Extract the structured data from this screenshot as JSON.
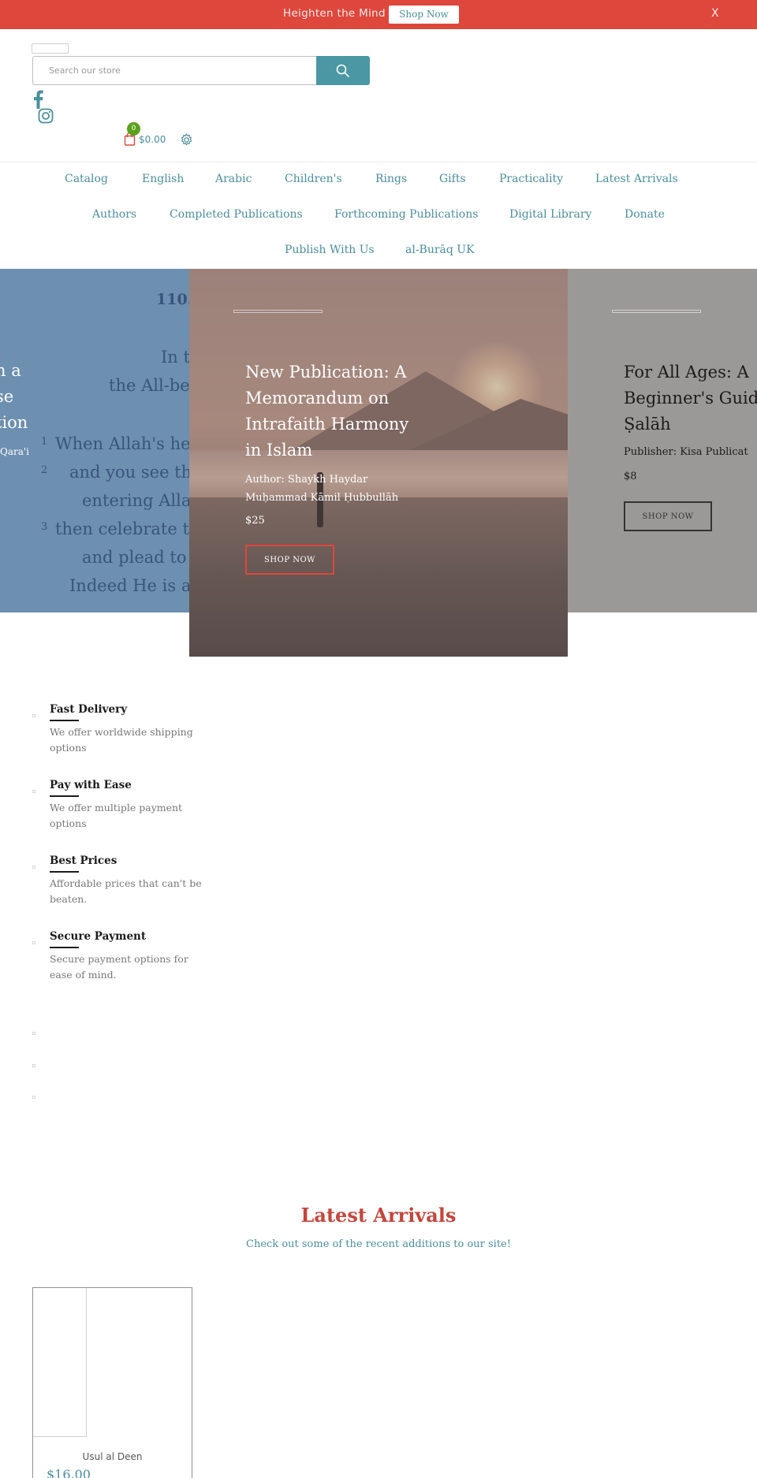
{
  "announcement": {
    "text": "Heighten the Mind",
    "button_label": "Shop Now",
    "close_label": "X"
  },
  "header": {
    "search_placeholder": "Search our store",
    "search_icon": "search-icon",
    "social": [
      "facebook-icon",
      "instagram-icon"
    ],
    "cart_count": "0",
    "cart_total": "$0.00",
    "settings_icon": "gear-icon"
  },
  "nav": {
    "row1": [
      "Catalog",
      "English",
      "Arabic",
      "Children's",
      "Rings",
      "Gifts",
      "Practicality",
      "Latest Arrivals"
    ],
    "row2": [
      "Authors",
      "Completed Publications",
      "Forthcoming Publications",
      "Digital Library",
      "Donate"
    ],
    "row3": [
      "Publish With Us",
      "al-Burāq UK"
    ]
  },
  "hero": {
    "left": {
      "scripture": [
        "110.",
        "In t",
        "the All-be",
        "When Allah's hel",
        "and you see the",
        "entering Allah",
        "then celebrate the",
        "and plead to H",
        "Indeed He is al"
      ],
      "title_lines": [
        "h a",
        "se",
        "tion"
      ],
      "subtitle": "Qara'i"
    },
    "center": {
      "title_lines": [
        "New Publication: A",
        "Memorandum on",
        "Intrafaith Harmony",
        "in Islam"
      ],
      "author_lines": [
        "Author: Shaykh Haydar",
        "Muḥammad Kāmil Ḥubbullāh"
      ],
      "price": "$25",
      "button_label": "SHOP NOW"
    },
    "right": {
      "title_lines": [
        "For All Ages: A",
        "Beginner's Guid",
        "Ṣalāh"
      ],
      "publisher": "Publisher: Kisa Publicat",
      "price": "$8",
      "button_label": "SHOP NOW"
    }
  },
  "features": [
    {
      "title": "Fast Delivery",
      "desc_lines": [
        "We offer worldwide shipping",
        "options"
      ]
    },
    {
      "title": "Pay with Ease",
      "desc_lines": [
        "We offer multiple payment",
        "options"
      ]
    },
    {
      "title": "Best Prices",
      "desc_lines": [
        "Affordable prices that can't be",
        "beaten."
      ]
    },
    {
      "title": "Secure Payment",
      "desc_lines": [
        "Secure payment options for",
        "ease of mind."
      ]
    }
  ],
  "latest": {
    "title": "Latest Arrivals",
    "subtitle": "Check out some of the recent additions to our site!",
    "products": [
      {
        "name": "Usul al Deen",
        "price": "$16.00"
      }
    ]
  },
  "colors": {
    "announcement_bg": "#dd473c",
    "accent_teal": "#4a8f9c",
    "cart_badge": "#5aa21a",
    "heading_red": "#c4463c"
  }
}
